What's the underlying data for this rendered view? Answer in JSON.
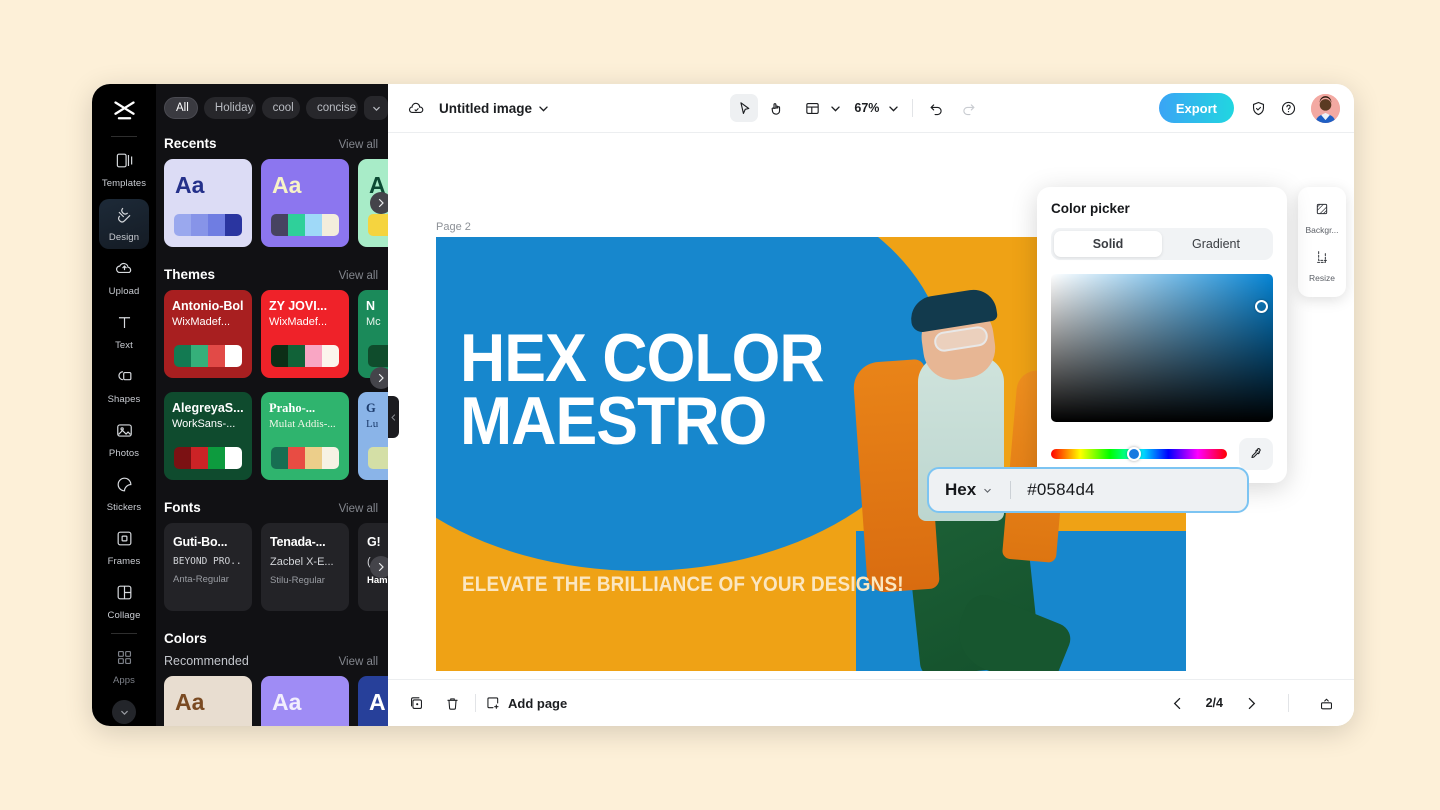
{
  "app": {
    "background_color": "#fdf0d8"
  },
  "rail": {
    "logo_name": "capcut-logo",
    "items": [
      {
        "label": "Templates",
        "icon": "templates-icon",
        "active": false
      },
      {
        "label": "Design",
        "icon": "design-icon",
        "active": true
      },
      {
        "label": "Upload",
        "icon": "upload-cloud-icon",
        "active": false
      },
      {
        "label": "Text",
        "icon": "text-icon",
        "active": false
      },
      {
        "label": "Shapes",
        "icon": "shapes-icon",
        "active": false
      },
      {
        "label": "Photos",
        "icon": "photos-icon",
        "active": false
      },
      {
        "label": "Stickers",
        "icon": "stickers-icon",
        "active": false
      },
      {
        "label": "Frames",
        "icon": "frames-icon",
        "active": false
      },
      {
        "label": "Collage",
        "icon": "collage-icon",
        "active": false
      },
      {
        "label": "Apps",
        "icon": "apps-grid-icon",
        "active": false
      }
    ],
    "collapse_icon": "chevron-down-icon"
  },
  "panel": {
    "chips": [
      {
        "label": "All",
        "active": true
      },
      {
        "label": "Holiday",
        "active": false
      },
      {
        "label": "cool",
        "active": false
      },
      {
        "label": "concise",
        "active": false
      }
    ],
    "chips_more_icon": "chevron-down-icon",
    "view_all": "View all",
    "sections": {
      "recents": {
        "title": "Recents",
        "cards": [
          {
            "aa": "Aa",
            "bg": "#dcdcf5",
            "aa_color": "#24308a",
            "swatches": [
              "#9aa8ee",
              "#8794e8",
              "#7d8ae6",
              "#2a35a0"
            ]
          },
          {
            "aa": "Aa",
            "bg": "#8c76ef",
            "aa_color": "#f7f3c8",
            "swatches": [
              "#474361",
              "#2fd09a",
              "#9fd9f8",
              "#f3eddc"
            ]
          },
          {
            "aa": "A",
            "bg": "#a8ecc8",
            "aa_color": "#0c4a33",
            "swatches": [
              "#f5d43f",
              "#f5d43f",
              "#f5d43f",
              "#f5d43f"
            ]
          }
        ]
      },
      "themes": {
        "title": "Themes",
        "cards": [
          {
            "t1": "Antonio-Bold",
            "t2": "WixMadef...",
            "bg": "#a81f20",
            "t1_color": "#ffffff",
            "t2_color": "#ffffff",
            "swatches": [
              "#137a52",
              "#35b07a",
              "#e24a47",
              "#ffffff"
            ]
          },
          {
            "t1": "ZY JOVI...",
            "t2": "WixMadef...",
            "bg": "#ef2229",
            "t1_color": "#ffffff",
            "t2_color": "#ffffff",
            "swatches": [
              "#0c2e16",
              "#116238",
              "#f9a6c4",
              "#fbf5ec"
            ]
          },
          {
            "t1": "N",
            "t2": "Mc",
            "bg": "#1b8a5a",
            "t1_color": "#ffffff",
            "t2_color": "#e8f5ed",
            "swatches": [
              "#0f4c2c",
              "#0f4c2c",
              "#0f4c2c",
              "#0f4c2c"
            ]
          },
          {
            "t1": "AlegreyaS...",
            "t2": "WorkSans-...",
            "bg": "#0f4b2e",
            "t1_color": "#ffffff",
            "t2_color": "#ffffff",
            "swatches": [
              "#7b1113",
              "#cc2326",
              "#0d9b3e",
              "#ffffff"
            ]
          },
          {
            "t1": "Praho-...",
            "t2": "Mulat Addis-...",
            "bg": "#2fb46e",
            "t1_color": "#ffffff",
            "t2_color": "#f3f6e8",
            "swatches": [
              "#176e52",
              "#e84c43",
              "#ecce8a",
              "#f6f2e4"
            ]
          },
          {
            "t1": "G",
            "t2": "Lu",
            "bg": "#8ab4e8",
            "t1_color": "#1b3a6b",
            "t2_color": "#1b3a6b",
            "swatches": [
              "#d4dfa6",
              "#d4dfa6",
              "#d4dfa6",
              "#d4dfa6"
            ]
          }
        ]
      },
      "fonts": {
        "title": "Fonts",
        "cards": [
          {
            "f1": "Guti-Bo...",
            "f2": "BEYOND PRO...",
            "f3": "Anta-Regular"
          },
          {
            "f1": "Tenada-...",
            "f2": "Zacbel X-E...",
            "f3": "Stilu-Regular"
          },
          {
            "f1": "G!",
            "f2": "(",
            "f3": "Ham"
          }
        ]
      },
      "colors": {
        "title": "Colors",
        "subtitle": "Recommended",
        "cards": [
          {
            "aa": "Aa",
            "bg": "#e8ddd0",
            "aa_color": "#7a4a22"
          },
          {
            "aa": "Aa",
            "bg": "#9f8cf5",
            "aa_color": "#f2eefd"
          },
          {
            "aa": "A",
            "bg": "#27409a",
            "aa_color": "#ffffff"
          }
        ]
      }
    },
    "next_arrow_icon": "chevron-right-icon",
    "collapse_handle_icon": "chevron-left-icon"
  },
  "topbar": {
    "cloud_icon": "cloud-save-icon",
    "doc_title": "Untitled image",
    "title_caret_icon": "chevron-down-icon",
    "tools": [
      {
        "name": "select-tool",
        "icon": "cursor-arrow-icon",
        "selected": true
      },
      {
        "name": "hand-tool",
        "icon": "hand-icon",
        "selected": false
      },
      {
        "name": "layout-tool",
        "icon": "layout-grid-icon",
        "selected": false
      }
    ],
    "layout_caret_icon": "chevron-down-icon",
    "zoom_level": "67%",
    "zoom_caret_icon": "chevron-down-icon",
    "undo_icon": "undo-arrow-icon",
    "redo_icon": "redo-arrow-icon",
    "export_label": "Export",
    "shield_icon": "shield-check-icon",
    "help_icon": "question-circle-icon",
    "avatar_name": "user-avatar"
  },
  "canvas": {
    "page_label": "Page 2",
    "design": {
      "headline_line1": "HEX COLOR",
      "headline_line2": "MAESTRO",
      "subline": "ELEVATE THE BRILLIANCE OF YOUR DESIGNS!",
      "bg_color": "#efa215",
      "accent_color": "#1787cd",
      "headline_color": "#ffffff",
      "subline_color": "#fbe6c0"
    }
  },
  "color_picker": {
    "title": "Color picker",
    "tabs": [
      {
        "label": "Solid",
        "active": true
      },
      {
        "label": "Gradient",
        "active": false
      }
    ],
    "eyedropper_icon": "eyedropper-icon",
    "hex_mode_label": "Hex",
    "hex_mode_caret_icon": "chevron-down-icon",
    "hex_value": "#0584d4",
    "selected_color": "#0584d4"
  },
  "right_toolbar": {
    "items": [
      {
        "label": "Backgr...",
        "icon": "background-swatch-icon"
      },
      {
        "label": "Resize",
        "icon": "resize-frame-icon"
      }
    ]
  },
  "bottombar": {
    "duplicate_icon": "duplicate-page-icon",
    "delete_icon": "trash-icon",
    "add_page_icon": "add-page-icon",
    "add_page_label": "Add page",
    "prev_icon": "chevron-left-icon",
    "page_indicator": "2/4",
    "next_icon": "chevron-right-icon",
    "present_icon": "present-icon"
  }
}
